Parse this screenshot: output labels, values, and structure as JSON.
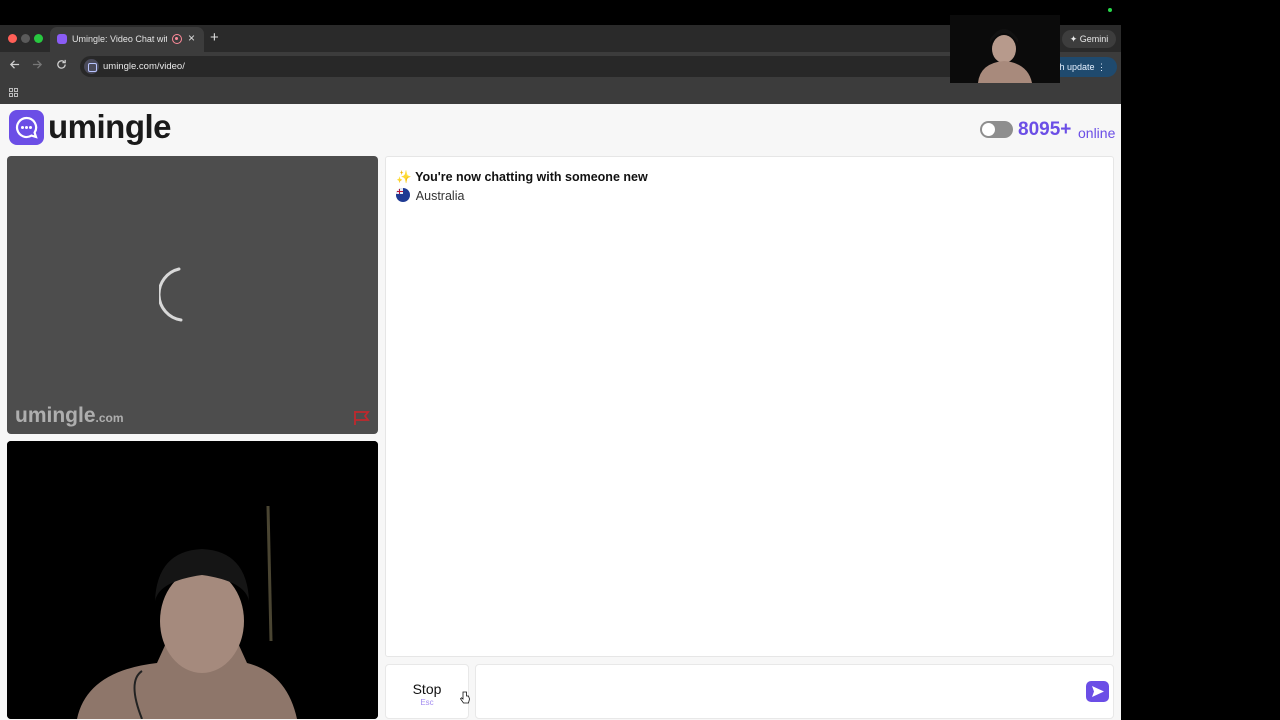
{
  "browser": {
    "tab_title": "Umingle: Video Chat with",
    "new_tab_symbol": "+",
    "close_symbol": "×",
    "gemini_label": "✦ Gemini",
    "url": "umingle.com/video/",
    "update_label": "sh update ⋮"
  },
  "header": {
    "logo_text": "umingle",
    "online_count": "8095+",
    "online_label": "online"
  },
  "stranger_video": {
    "watermark_main": "umingle",
    "watermark_suffix": ".com"
  },
  "chat": {
    "status_emoji": "✨",
    "status_text": "You're now chatting with someone new",
    "country": "Australia"
  },
  "controls": {
    "stop_label": "Stop",
    "stop_hint": "Esc",
    "message_placeholder": ""
  },
  "colors": {
    "brand": "#6b4ee6",
    "page_bg": "#f7f7f7"
  }
}
